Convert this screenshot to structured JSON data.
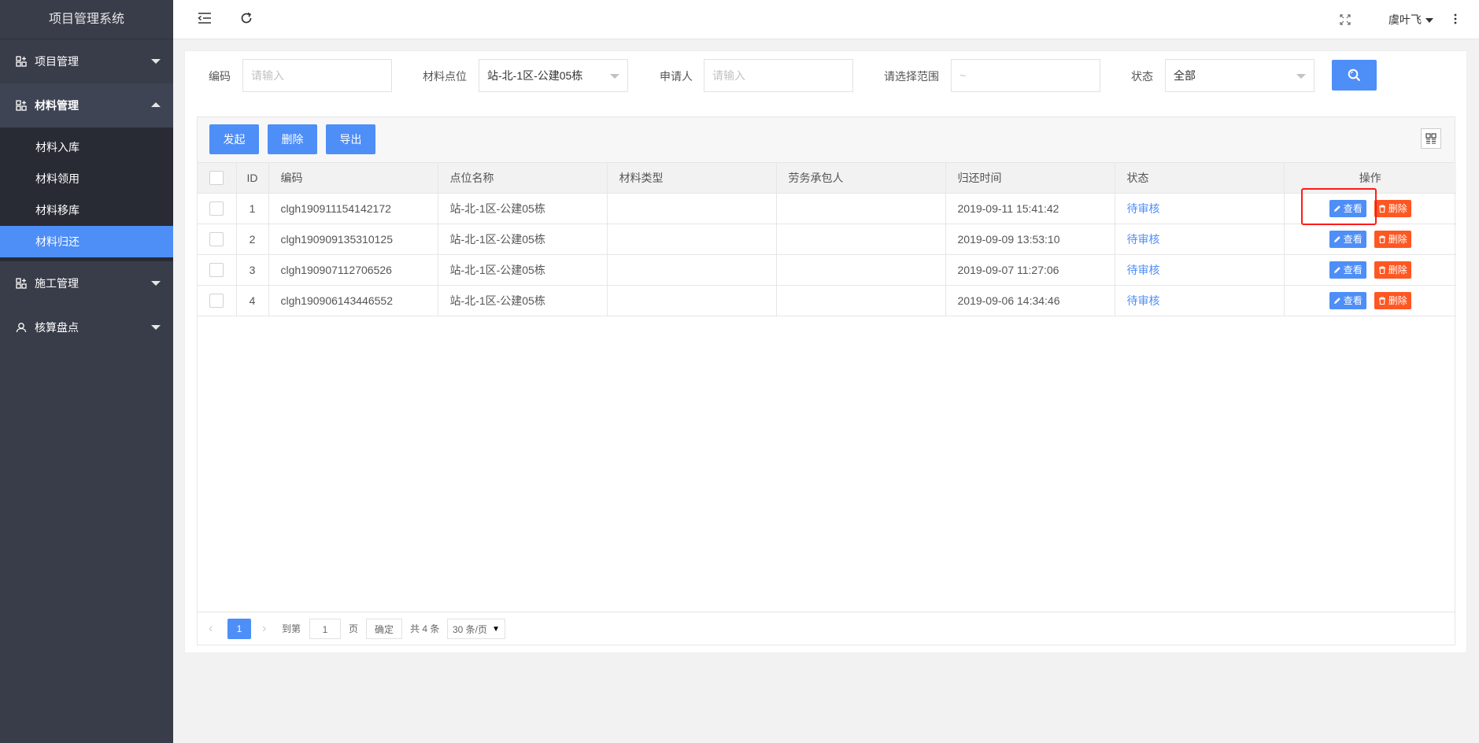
{
  "app": {
    "title": "项目管理系统"
  },
  "sidebar": {
    "groups": [
      {
        "label": "项目管理",
        "expanded": false
      },
      {
        "label": "材料管理",
        "expanded": true
      },
      {
        "label": "施工管理",
        "expanded": false
      },
      {
        "label": "核算盘点",
        "expanded": false
      }
    ],
    "sub_items": [
      "材料入库",
      "材料领用",
      "材料移库",
      "材料归还"
    ],
    "active_sub": "材料归还"
  },
  "header": {
    "user": "虞叶飞"
  },
  "filters": {
    "code_label": "编码",
    "code_placeholder": "请输入",
    "site_label": "材料点位",
    "site_value": "站-北-1区-公建05栋",
    "applicant_label": "申请人",
    "applicant_placeholder": "请输入",
    "range_label": "请选择范围",
    "range_placeholder": "~",
    "status_label": "状态",
    "status_value": "全部"
  },
  "toolbar": {
    "start_label": "发起",
    "delete_label": "删除",
    "export_label": "导出"
  },
  "table": {
    "headers": [
      "ID",
      "编码",
      "点位名称",
      "材料类型",
      "劳务承包人",
      "归还时间",
      "状态",
      "操作"
    ],
    "view_label": "查看",
    "delete_label": "删除",
    "rows": [
      {
        "id": "1",
        "code": "clgh190911154142172",
        "site": "站-北-1区-公建05栋",
        "material_type": "",
        "contractor": "",
        "return_time": "2019-09-11 15:41:42",
        "status": "待审核"
      },
      {
        "id": "2",
        "code": "clgh190909135310125",
        "site": "站-北-1区-公建05栋",
        "material_type": "",
        "contractor": "",
        "return_time": "2019-09-09 13:53:10",
        "status": "待审核"
      },
      {
        "id": "3",
        "code": "clgh190907112706526",
        "site": "站-北-1区-公建05栋",
        "material_type": "",
        "contractor": "",
        "return_time": "2019-09-07 11:27:06",
        "status": "待审核"
      },
      {
        "id": "4",
        "code": "clgh190906143446552",
        "site": "站-北-1区-公建05栋",
        "material_type": "",
        "contractor": "",
        "return_time": "2019-09-06 14:34:46",
        "status": "待审核"
      }
    ]
  },
  "pager": {
    "current": "1",
    "goto_label": "到第",
    "goto_value": "1",
    "page_unit": "页",
    "confirm_label": "确定",
    "total_label": "共 4 条",
    "page_size": "30 条/页"
  },
  "colors": {
    "primary": "#4e8ef7",
    "danger": "#ff5722",
    "sidebar": "#393d49",
    "highlight": "#ff1a1a"
  }
}
